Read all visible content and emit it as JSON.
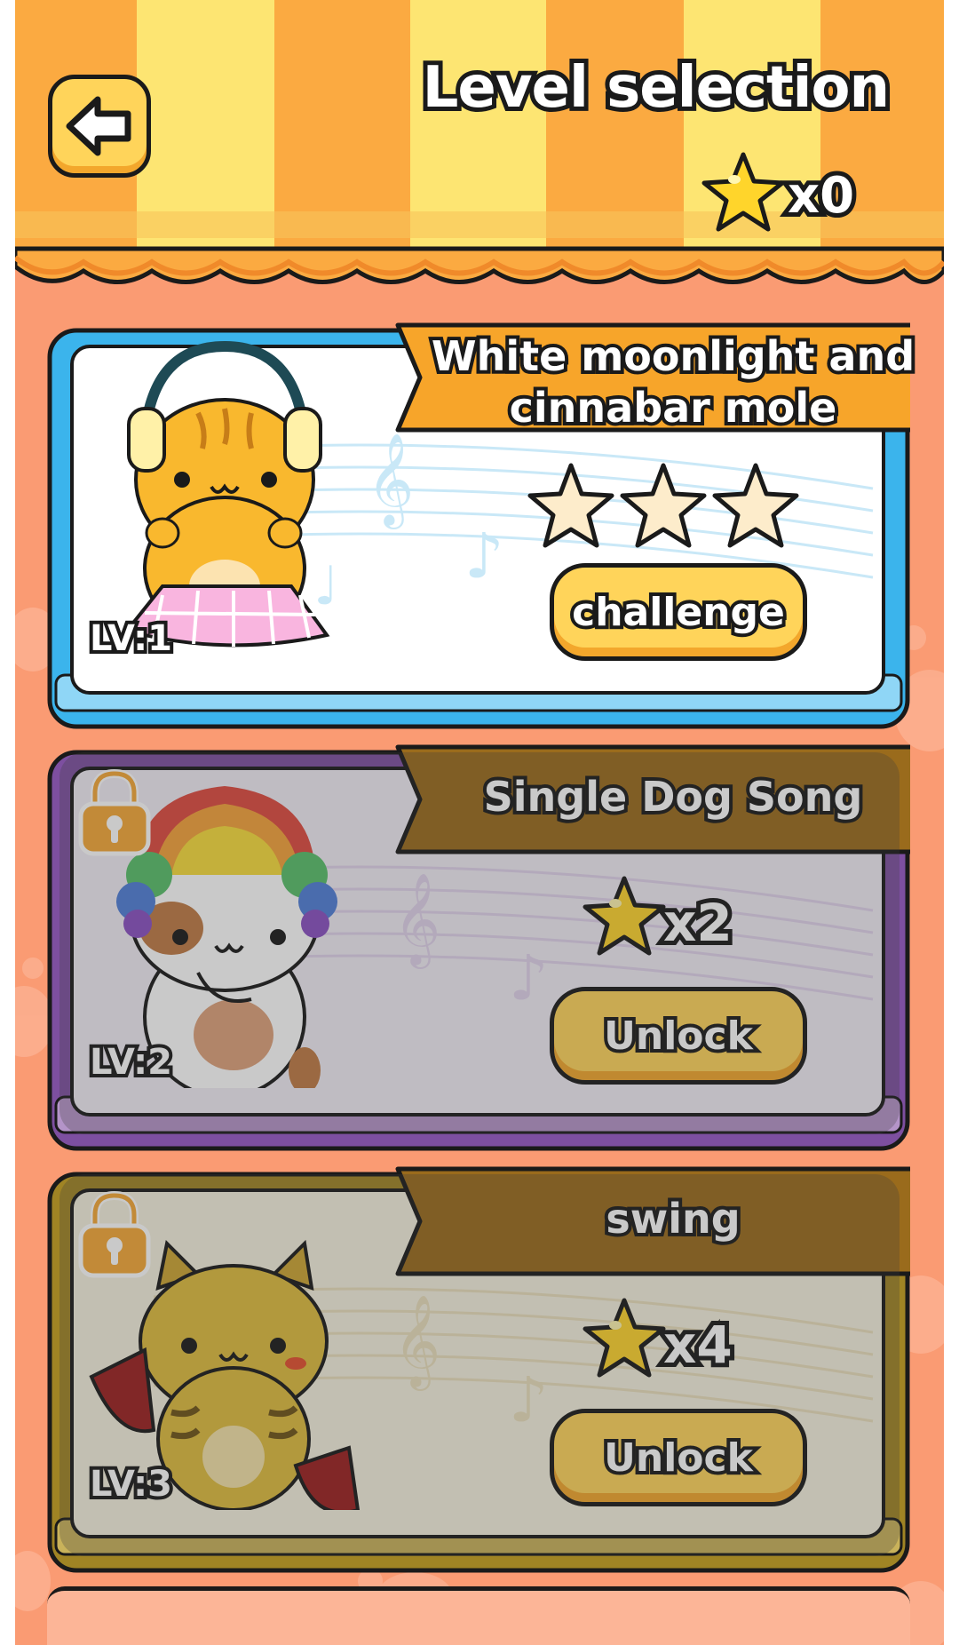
{
  "header": {
    "title": "Level selection",
    "back_icon": "arrow-left-icon",
    "stars_owned": "x0"
  },
  "levels": [
    {
      "title_line1": "White moonlight and",
      "title_line2": "cinnabar mole",
      "level_label": "LV:1",
      "locked": false,
      "rating_stars": 0,
      "rating_max": 3,
      "button_label": "challenge",
      "theme": "#3bb4ec",
      "banner": "#f7a52a"
    },
    {
      "title": "Single Dog Song",
      "level_label": "LV:2",
      "locked": true,
      "unlock_cost": "x2",
      "button_label": "Unlock",
      "theme": "#7d4fa0",
      "banner": "#9a6b1c"
    },
    {
      "title": "swing",
      "level_label": "LV:3",
      "locked": true,
      "unlock_cost": "x4",
      "button_label": "Unlock",
      "theme": "#a08424",
      "banner": "#9a6b1c"
    }
  ],
  "colors": {
    "background": "#fa9b73",
    "awning_orange": "#fbaa41",
    "awning_yellow": "#fde572",
    "button_yellow": "#ffd45a",
    "star_yellow": "#ffd52b"
  }
}
